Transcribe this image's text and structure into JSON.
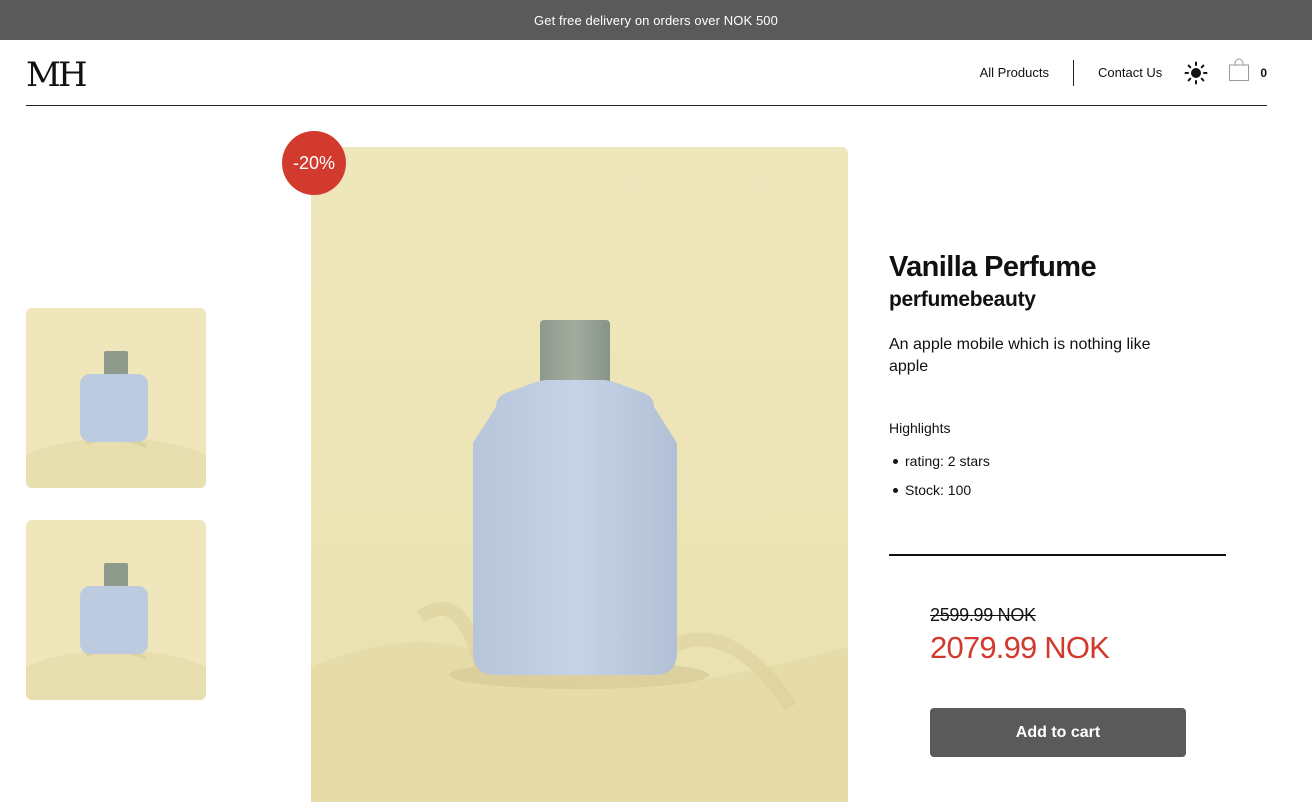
{
  "promo": {
    "text": "Get free delivery on orders over NOK 500"
  },
  "header": {
    "logo": "MH",
    "nav": {
      "all_products": "All Products",
      "contact_us": "Contact Us"
    },
    "theme_icon": "sun-icon",
    "cart_icon": "shopping-bag-icon",
    "cart_count": "0"
  },
  "product": {
    "discount_badge": "-20%",
    "name": "Vanilla Perfume",
    "brand": "perfumebeauty",
    "description": "An apple mobile which is nothing like apple",
    "highlights_title": "Highlights",
    "highlights": [
      "rating: 2 stars",
      "Stock: 100"
    ],
    "price_old": "2599.99 NOK",
    "price_new": "2079.99 NOK",
    "add_to_cart": "Add to cart"
  },
  "colors": {
    "accent_red": "#d23a2e",
    "dark_gray": "#5a5a5a",
    "image_background": "#efe7bb"
  }
}
